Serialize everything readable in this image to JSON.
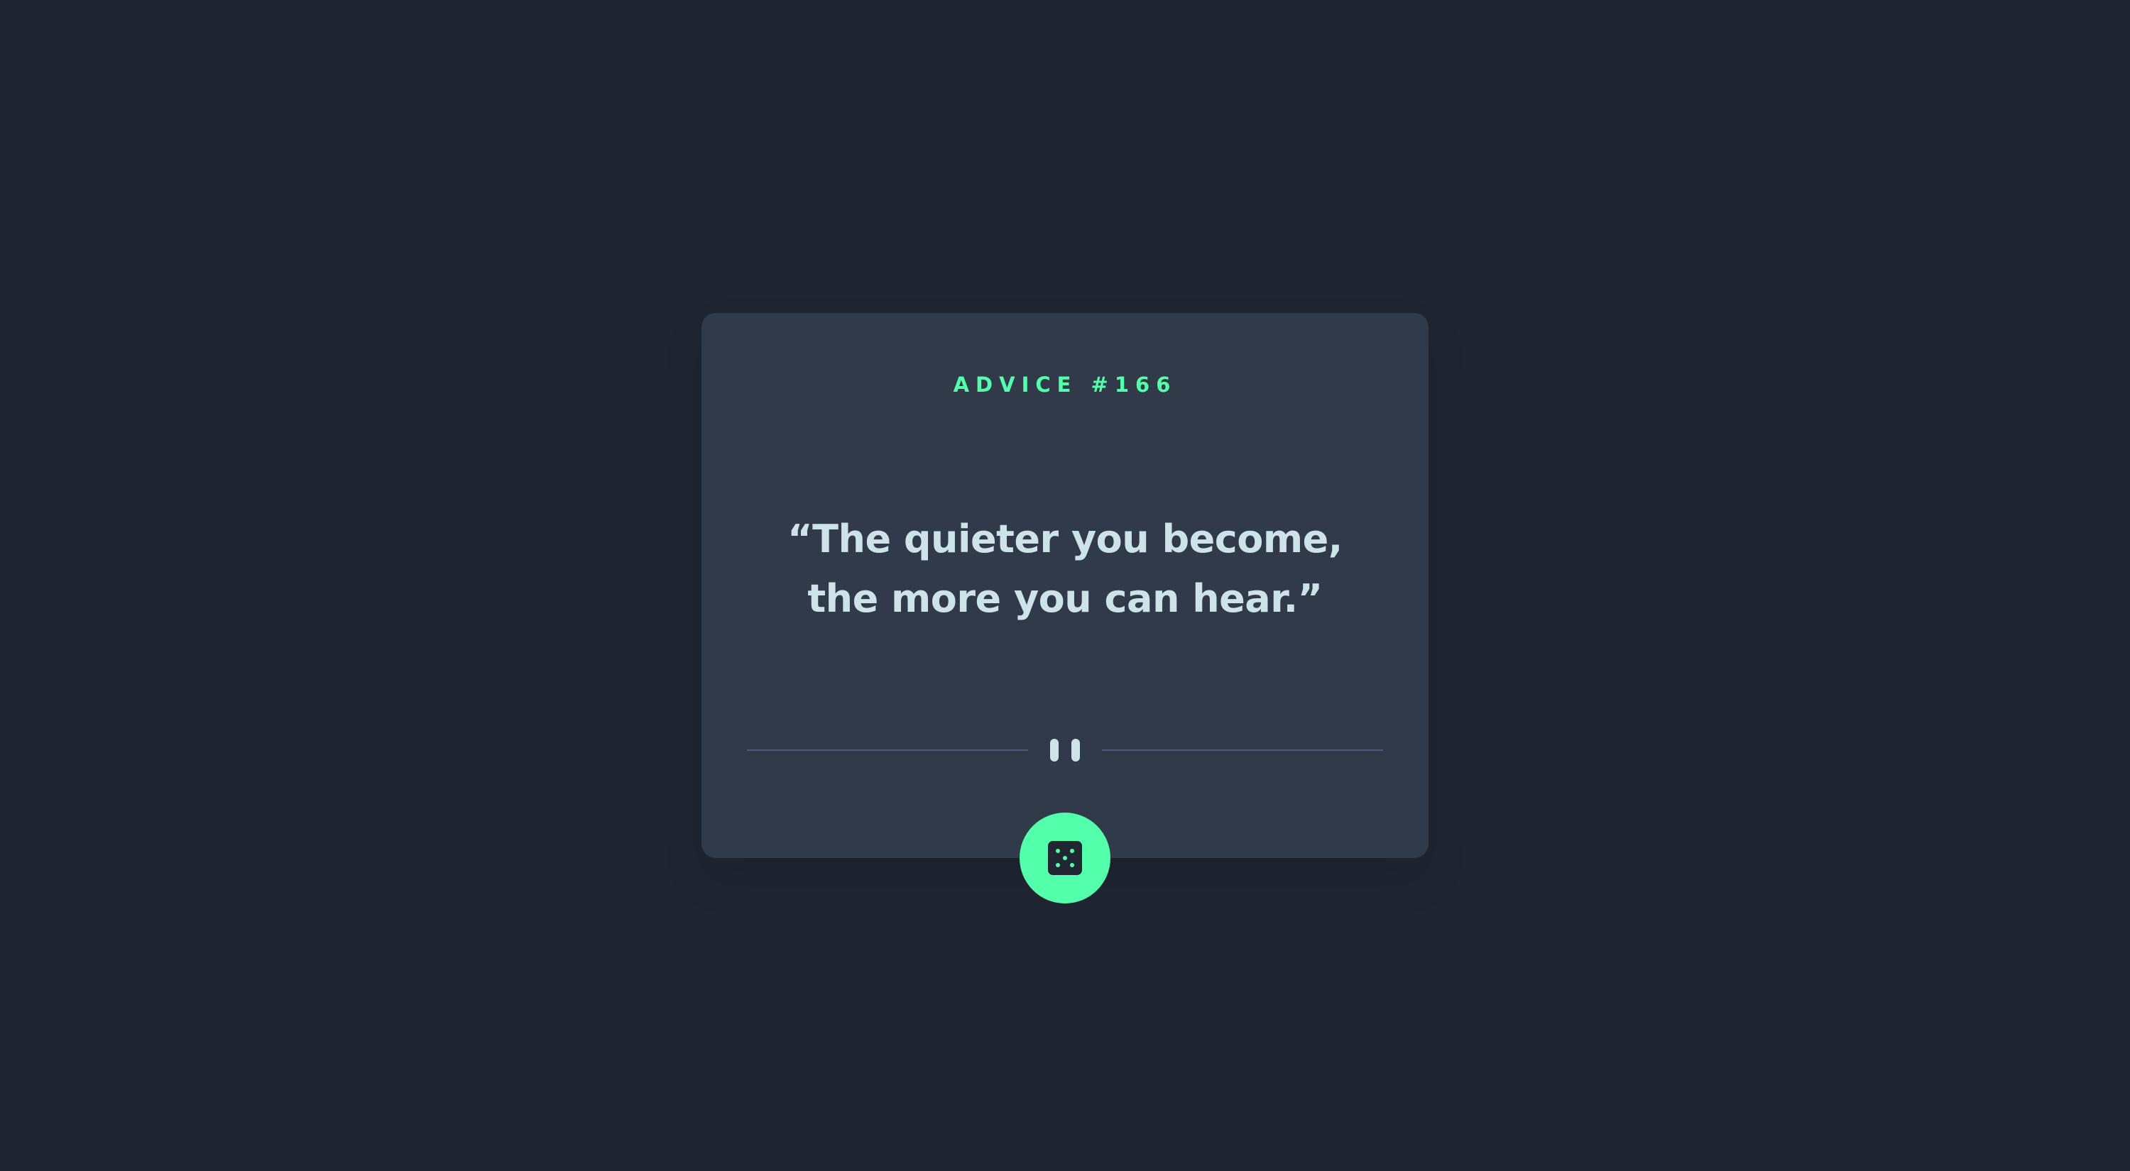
{
  "advice": {
    "id_label": "ADVICE #166",
    "quote": "“The quieter you become, the more you can hear.”"
  },
  "generate_button": {
    "icon": "dice-icon",
    "color": "#53ffaa"
  },
  "divider": {
    "icon": "pause-icon"
  },
  "colors": {
    "background": "#1f2632",
    "card": "#313a48",
    "accent": "#53ffaa",
    "text": "#cee3e9",
    "divider": "#4f5d74"
  }
}
